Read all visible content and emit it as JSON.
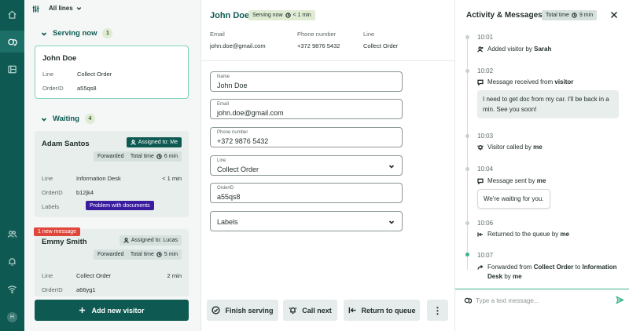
{
  "queue": {
    "filter_label": "All lines",
    "serving_now": {
      "title": "Serving now",
      "count": "1",
      "card": {
        "name": "John Doe",
        "line_label": "Line",
        "line_value": "Collect Order",
        "order_label": "OrderID",
        "order_value": "a55qs8"
      }
    },
    "waiting": {
      "title": "Waiting",
      "count": "4",
      "cards": [
        {
          "name": "Adam Santos",
          "assigned": "Assigned to: Me",
          "forwarded": "Forwarded",
          "total_time": "Total time",
          "total_value": "6 min",
          "line_label": "Line",
          "line_value": "Information Desk",
          "line_time": "< 1 min",
          "order_label": "OrderID",
          "order_value": "b12jk4",
          "labels_label": "Labels",
          "label_chip": "Problem with documents"
        },
        {
          "new_message": "1 new message",
          "name": "Emmy Smith",
          "assigned": "Assigned to: Lucas",
          "forwarded": "Forwarded",
          "total_time": "Total time",
          "total_value": "5 min",
          "line_label": "Line",
          "line_value": "Collect Order",
          "line_time": "2 min",
          "order_label": "OrderID",
          "order_value": "a66yg1"
        }
      ]
    },
    "add_visitor": "Add new visitor"
  },
  "main": {
    "visitor_name": "John Doe",
    "serving_badge": "Serving now",
    "serving_time": "< 1 min",
    "header": {
      "email_label": "Email",
      "email_value": "john.doe@gmail.com",
      "phone_label": "Phone number",
      "phone_value": "+372 9876 5432",
      "line_label": "Line",
      "line_value": "Collect Order"
    },
    "form": {
      "name_label": "Name",
      "name_value": "John Doe",
      "email_label": "Email",
      "email_value": "john.doe@gmail.com",
      "phone_label": "Phone number",
      "phone_value": "+372 9876 5432",
      "line_label": "Line",
      "line_value": "Collect Order",
      "order_label": "OrderID",
      "order_value": "a55qs8",
      "labels_placeholder": "Labels"
    },
    "actions": {
      "finish": "Finish serving",
      "call_next": "Call next",
      "return": "Return to queue",
      "more": "⋮"
    }
  },
  "activity": {
    "title": "Activity & Messages",
    "total_label": "Total time",
    "total_value": "9 min",
    "events": [
      {
        "time": "10:01",
        "text": "Added visitor by ",
        "bold": "Sarah"
      },
      {
        "time": "10:02",
        "text": "Message received from ",
        "bold": "visitor",
        "bubble": "I need to get doc from my car. I'll be back in a min. See you soon!"
      },
      {
        "time": "10:03",
        "text": "Visitor called by ",
        "bold": "me"
      },
      {
        "time": "10:04",
        "text": "Message sent by ",
        "bold": "me",
        "bubble": "We're waiting for you."
      },
      {
        "time": "10:06",
        "text": "Returned to the queue by ",
        "bold": "me"
      },
      {
        "time": "10:07",
        "t1": "Forwarded from ",
        "b1": "Collect Order",
        "t2": " to ",
        "b2": "Information Desk",
        "t3": " by ",
        "b3": "me"
      }
    ],
    "message_placeholder": "Type a text message..."
  },
  "rail": {
    "avatar_initial": "H"
  },
  "colors": {
    "brand": "#0e5a52",
    "accent": "#3cb48c",
    "label_chip": "#3a1d9e",
    "new_message": "#e0473b",
    "serving_badge": "#e0ebd3"
  }
}
